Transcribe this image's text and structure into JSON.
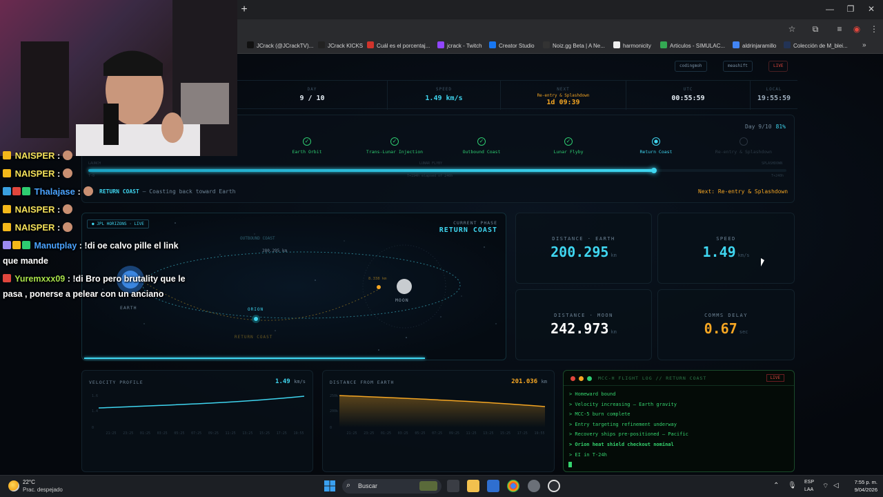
{
  "browser": {
    "bookmarks": [
      {
        "label": "JCrack (@JCrackTV)...",
        "color": "#111111"
      },
      {
        "label": "JCrack KICKS",
        "color": "#222222"
      },
      {
        "label": "Cuál es el porcentaj...",
        "color": "#d0342c"
      },
      {
        "label": "jcrack - Twitch",
        "color": "#9146ff"
      },
      {
        "label": "Creator Studio",
        "color": "#1877f2"
      },
      {
        "label": "Noiz.gg Beta | A Ne...",
        "color": "#333333"
      },
      {
        "label": "harmonicity",
        "color": "#eeeeee"
      },
      {
        "label": "Articulos - SIMULAC...",
        "color": "#34a853"
      },
      {
        "label": "aldrinjaramillo",
        "color": "#4285f4"
      },
      {
        "label": "Colección de M_blei...",
        "color": "#223355"
      }
    ],
    "more_icon": "chevron-double-right-icon"
  },
  "header": {
    "chips": [
      "codingmoh",
      "meashift",
      "LIVE"
    ]
  },
  "stats": [
    {
      "label": "DAY",
      "value": "9 / 10",
      "sub": ""
    },
    {
      "label": "SPEED",
      "value": "1.49 km/s",
      "sub": ""
    },
    {
      "label": "NEXT",
      "value": "1d 09:39",
      "sub": "Re-entry & Splashdown"
    },
    {
      "label": "UTC",
      "value": "00:55:59",
      "sub": ""
    },
    {
      "label": "LOCAL",
      "value": "19:55:59",
      "sub": ""
    }
  ],
  "timeline": {
    "day_label": "Day 9/10",
    "day_pct": "81%",
    "progress": 0.81,
    "milestones": [
      {
        "label": "Earth Orbit",
        "state": "done"
      },
      {
        "label": "Trans-Lunar Injection",
        "state": "done"
      },
      {
        "label": "Outbound Coast",
        "state": "done"
      },
      {
        "label": "Lunar Flyby",
        "state": "done"
      },
      {
        "label": "Return Coast",
        "state": "active"
      },
      {
        "label": "Re-entry & Splashdown",
        "state": "future"
      }
    ],
    "tiny_launch": "LAUNCH",
    "tiny_flyby": "LUNAR FLYBY",
    "tiny_splash": "SPLASHDOWN",
    "tiny_t0": "T-0",
    "tiny_elapsed": "T+194h elapsed of 240h",
    "tiny_t240": "T+240h",
    "phase_name": "RETURN COAST",
    "phase_desc": "— Coasting back toward Earth",
    "next": "Next: Re-entry & Splashdown"
  },
  "orbit": {
    "badge": "JPL HORIZONS · LIVE",
    "current_phase_label": "CURRENT PHASE",
    "current_phase": "RETURN COAST",
    "outbound_label": "OUTBOUND COAST",
    "return_label": "RETURN COAST",
    "distance_label": "280.295 km",
    "moon_dist_label": "8.338 km",
    "earth": "EARTH",
    "moon": "MOON",
    "orion": "ORION"
  },
  "metrics": [
    {
      "label": "DISTANCE · EARTH",
      "value": "200.295",
      "unit": "km",
      "color": "#3fd6f0"
    },
    {
      "label": "SPEED",
      "value": "1.49",
      "unit": "km/s",
      "color": "#3fd6f0"
    },
    {
      "label": "DISTANCE · MOON",
      "value": "242.973",
      "unit": "km",
      "color": "#ffffff"
    },
    {
      "label": "COMMS DELAY",
      "value": "0.67",
      "unit": "sec",
      "color": "#f5a623"
    }
  ],
  "velocity_chart": {
    "title": "VELOCITY PROFILE",
    "value": "1.49",
    "unit": "km/s",
    "ylabels": [
      "1.6",
      "1.4",
      "0"
    ],
    "xlabels": [
      "21:25",
      "23:25",
      "01:25",
      "03:25",
      "05:25",
      "07:25",
      "09:25",
      "11:25",
      "13:25",
      "15:25",
      "17:25",
      "19:55"
    ]
  },
  "distance_chart": {
    "title": "DISTANCE FROM EARTH",
    "value": "201.036",
    "unit": "km",
    "ylabels": [
      "250k",
      "200k",
      "0"
    ],
    "xlabels": [
      "21:25",
      "23:25",
      "01:25",
      "03:25",
      "05:25",
      "07:25",
      "09:25",
      "11:25",
      "13:25",
      "15:25",
      "17:25",
      "19:55"
    ]
  },
  "log": {
    "title": "MCC-H FLIGHT LOG // RETURN COAST",
    "live": "LIVE",
    "lines": [
      "> Homeward bound",
      "> Velocity increasing — Earth gravity",
      "> MCC-5 burn complete",
      "> Entry targeting refinement underway",
      "> Recovery ships pre-positioned — Pacific",
      "> Orion heat shield checkout nominal",
      "> EI in T-24h"
    ]
  },
  "chat": [
    {
      "user": "NAISPER",
      "text": ":",
      "style": "naisper"
    },
    {
      "user": "NAISPER",
      "text": ":",
      "style": "naisper"
    },
    {
      "user": "Thalajase",
      "text": ":",
      "style": "blue"
    },
    {
      "user": "NAISPER",
      "text": ":",
      "style": "naisper"
    },
    {
      "user": "NAISPER",
      "text": ":",
      "style": "naisper"
    },
    {
      "user": "Manutplay",
      "text": ": !di oe calvo pille el link",
      "text2": "que mande",
      "style": "blue"
    },
    {
      "user": "Yuremxxx09",
      "text": ": !di Bro pero brutality que le",
      "text2": "pasa , ponerse a pelear con un anciano",
      "style": "green"
    }
  ],
  "taskbar": {
    "temp": "22°C",
    "weather": "Prac. despejado",
    "search": "Buscar",
    "lang1": "ESP",
    "lang2": "LAA",
    "time": "7:55 p. m.",
    "date": "9/04/2026"
  }
}
